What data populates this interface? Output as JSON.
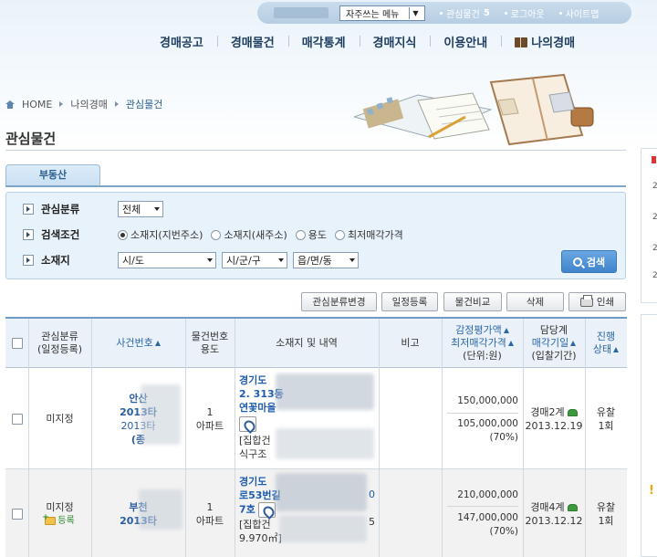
{
  "header": {
    "quick_menu": {
      "label": "자주쓰는 메뉴"
    },
    "links": [
      {
        "label": "관심물건",
        "count": "5"
      },
      {
        "label": "로그아웃"
      },
      {
        "label": "사이트맵"
      }
    ],
    "nav": [
      "경매공고",
      "경매물건",
      "매각통계",
      "경매지식",
      "이용안내",
      "나의경매"
    ]
  },
  "breadcrumb": [
    "HOME",
    "나의경매",
    "관심물건"
  ],
  "page_title": "관심물건",
  "tab": "부동산",
  "search": {
    "category": {
      "label": "관심분류",
      "value": "전체"
    },
    "condition": {
      "label": "검색조건",
      "options": [
        "소재지(지번주소)",
        "소재지(새주소)",
        "용도",
        "최저매각가격"
      ],
      "selected_index": 0
    },
    "location": {
      "label": "소재지",
      "sido": "시/도",
      "sigungu": "시/군/구",
      "dong": "읍/면/동"
    },
    "button": "검색"
  },
  "actions": [
    "관심분류변경",
    "일정등록",
    "물건비교",
    "삭제",
    "인쇄"
  ],
  "table": {
    "headers": {
      "category": [
        "관심분류",
        "(일정등록)"
      ],
      "case_no": "사건번호",
      "item_no": [
        "물건번호",
        "용도"
      ],
      "location": "소재지 및 내역",
      "note": "비고",
      "price": [
        "감정평가액",
        "최저매각가격",
        "(단위:원)"
      ],
      "dept": [
        "담당계",
        "매각기일",
        "(입찰기간)"
      ],
      "status": [
        "진행",
        "상태"
      ]
    },
    "rows": [
      {
        "category": "미지정",
        "case_lines": [
          "안산",
          "2013타",
          "2013타",
          "(종"
        ],
        "item_no": "1",
        "use": "아파트",
        "addr_lines": [
          "경기도 ",
          "2. 313동",
          "연꽃마을"
        ],
        "addr_extra": [
          "[집합건",
          "식구조 "
        ],
        "appraisal": "150,000,000",
        "minimum": "105,000,000",
        "ratio": "(70%)",
        "dept": "경매2계",
        "date": "2013.12.19",
        "status": [
          "유찰",
          "1회"
        ]
      },
      {
        "category": "미지정",
        "register": "등록",
        "case_lines": [
          "부천",
          "2013타"
        ],
        "item_no": "1",
        "use": "아파트",
        "addr_lines": [
          "경기도 ",
          "로53번길",
          "7호"
        ],
        "addr_extra": [
          "[집합건",
          "9.970㎡]"
        ],
        "addr_tail": [
          "0",
          "5"
        ],
        "appraisal": "210,000,000",
        "minimum": "147,000,000",
        "ratio": "(70%)",
        "dept": "경매4계",
        "date": "2013.12.12",
        "status": [
          "유찰",
          "1회"
        ]
      }
    ]
  },
  "side_panel": {
    "numbers": [
      "2",
      "2",
      "2",
      "2"
    ],
    "alert": "!"
  }
}
